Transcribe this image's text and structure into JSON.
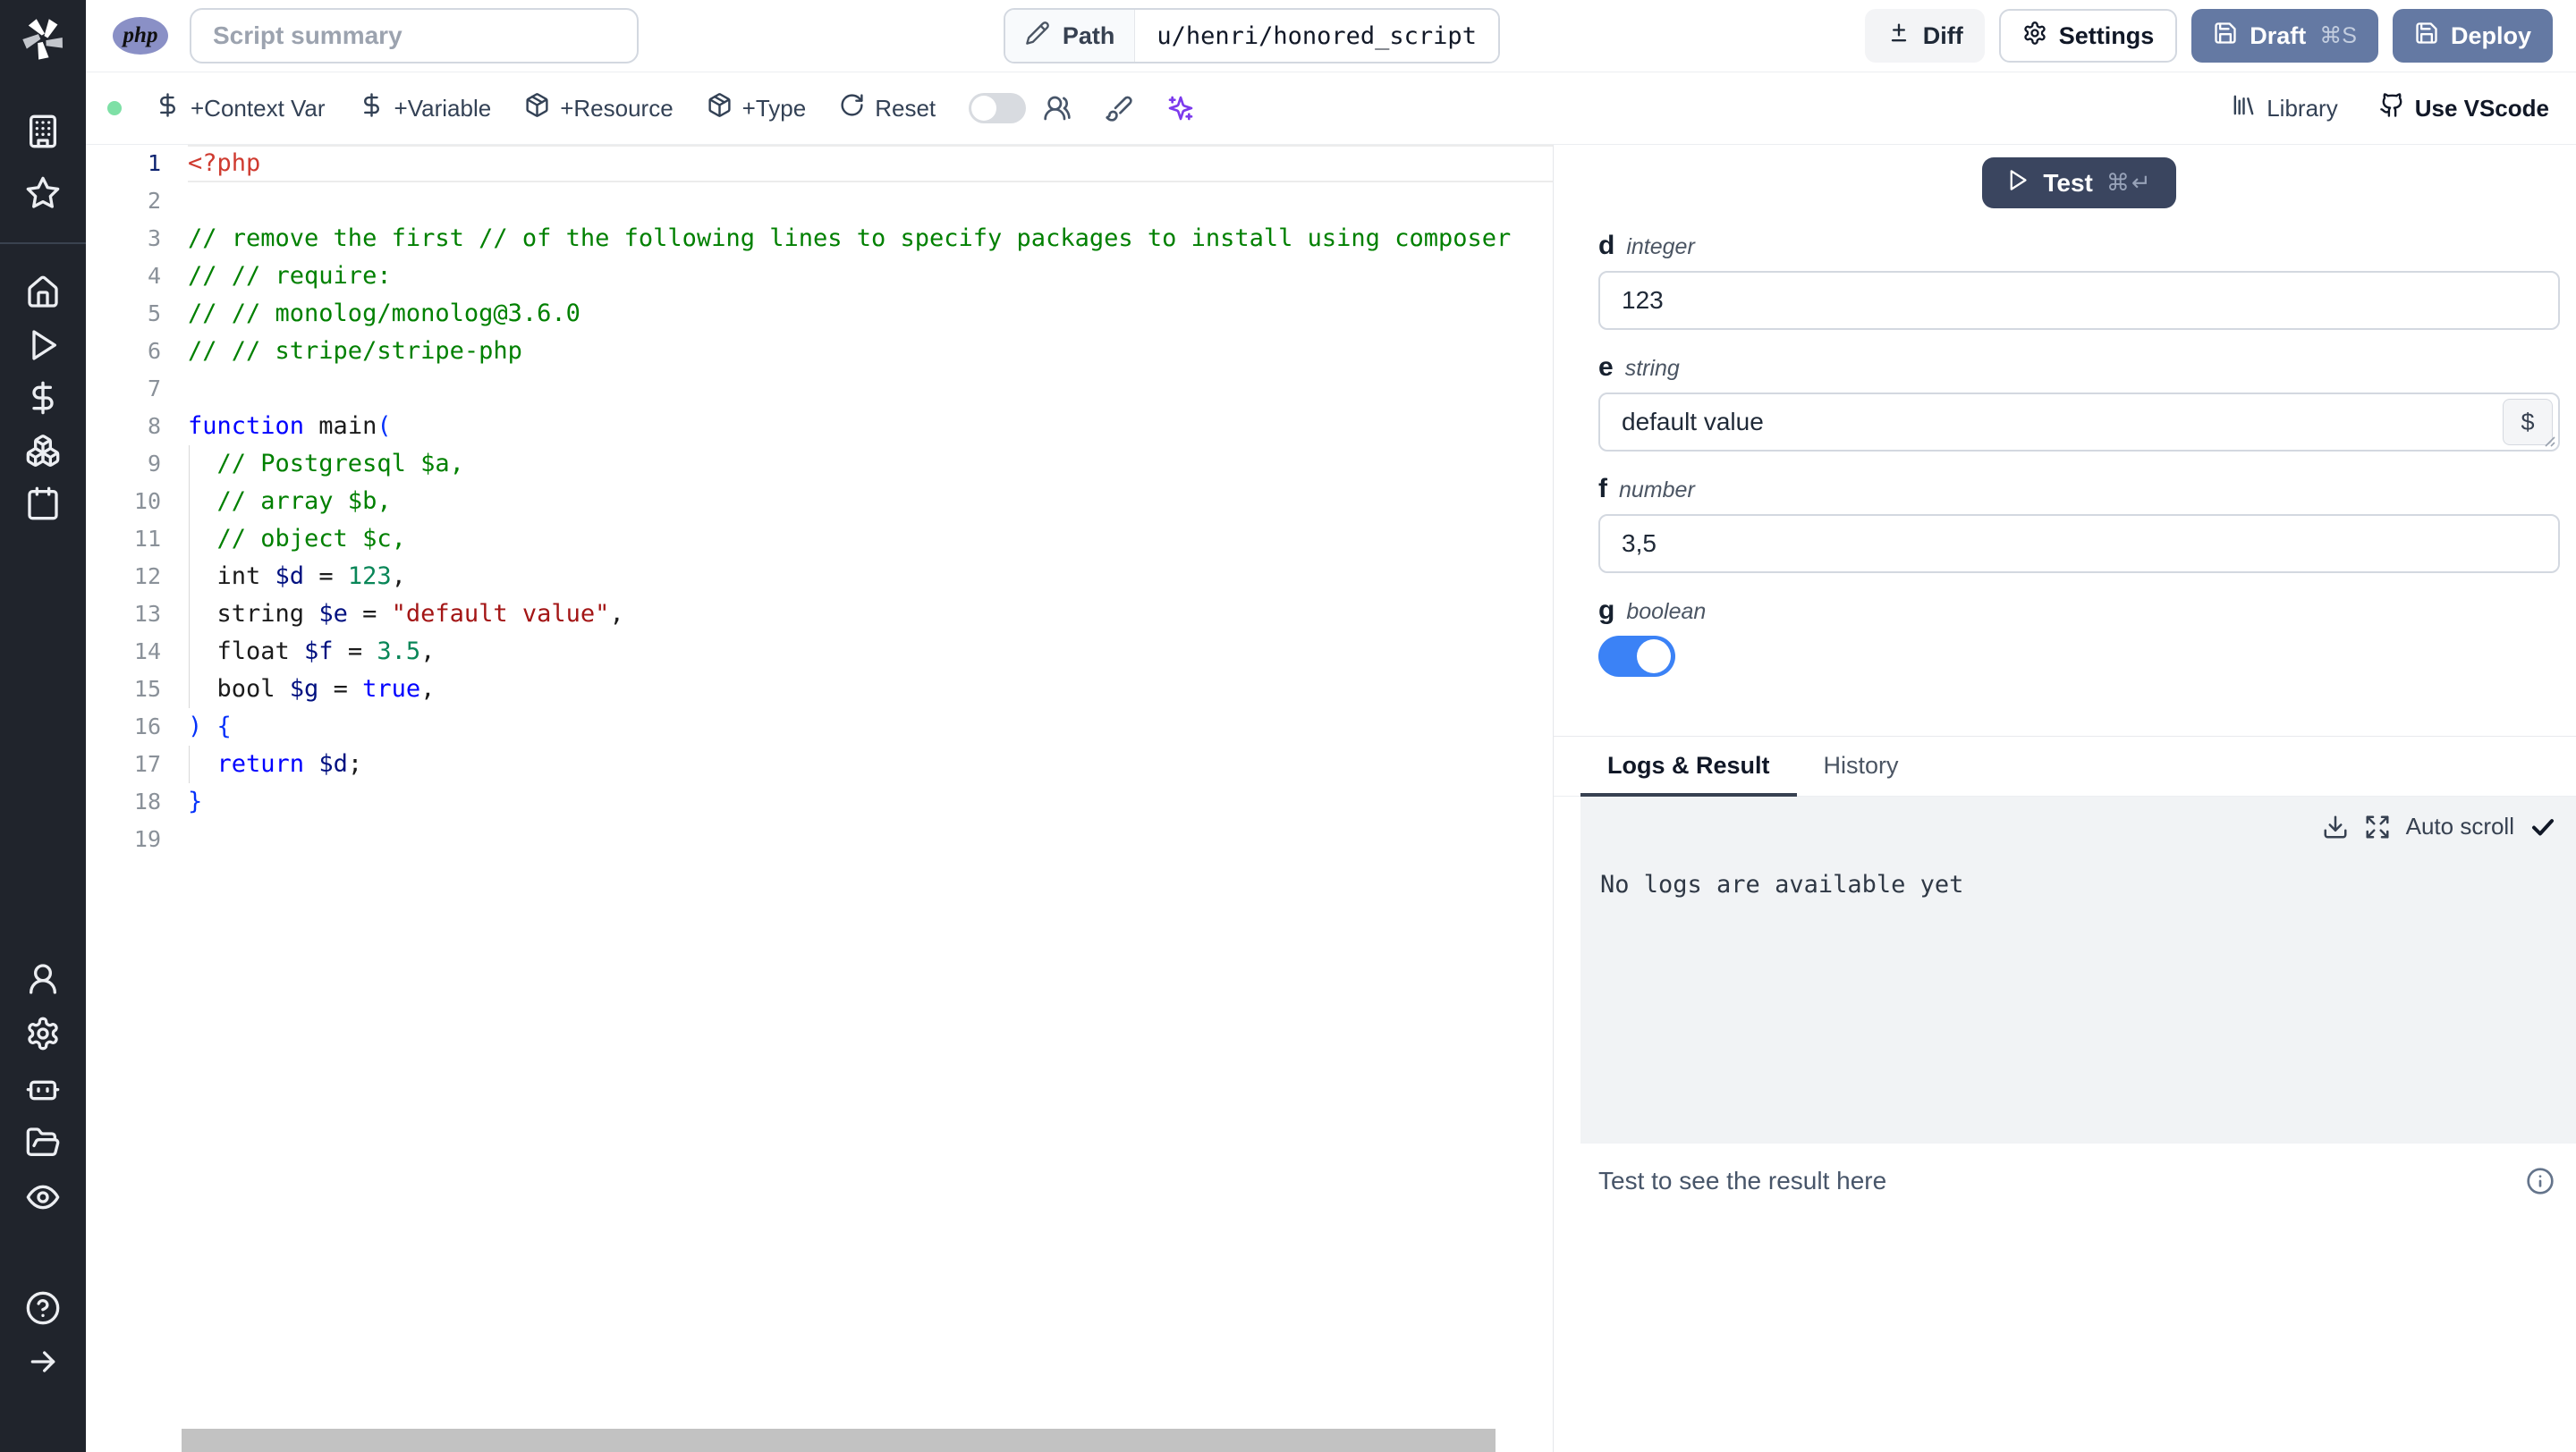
{
  "app": {
    "name": "Windmill script editor"
  },
  "colors": {
    "sidebar_bg": "#20242c",
    "slate_button": "#6479a3",
    "test_button": "#3a455f",
    "toggle_on": "#3b82f6",
    "php_badge": "#8a90c6",
    "status_dot": "#7ee0a6",
    "logs_bg": "#f1f3f5",
    "ai_accent": "#7c3aed",
    "code_meta": "#cf3b30",
    "code_comment": "#008000",
    "code_keyword": "#0000ff",
    "code_variable": "#001080",
    "code_number": "#098658",
    "code_string": "#a31515",
    "code_bracket": "#0431fa"
  },
  "header": {
    "language_badge": "php",
    "summary_placeholder": "Script summary",
    "path_label": "Path",
    "path_value": "u/henri/honored_script",
    "diff_label": "Diff",
    "settings_label": "Settings",
    "draft_label": "Draft",
    "draft_shortcut": "⌘S",
    "deploy_label": "Deploy"
  },
  "sidebar": {
    "top_icons": [
      "building",
      "star"
    ],
    "mid_icons": [
      "home",
      "play",
      "dollar",
      "boxes",
      "calendar"
    ],
    "lower_icons": [
      "user",
      "settings",
      "bot",
      "folder-open",
      "eye"
    ],
    "footer_icons": [
      "help-circle",
      "arrow-right"
    ]
  },
  "toolbar": {
    "items": [
      {
        "icon": "dollar",
        "label": "+Context Var"
      },
      {
        "icon": "dollar",
        "label": "+Variable"
      },
      {
        "icon": "package",
        "label": "+Resource"
      },
      {
        "icon": "package",
        "label": "+Type"
      },
      {
        "icon": "refresh",
        "label": "Reset"
      }
    ],
    "multiplayer_toggle_on": false,
    "icon_buttons": [
      "users",
      "brush",
      "sparkles"
    ],
    "library_label": "Library",
    "vscode_label": "Use VScode"
  },
  "editor": {
    "active_line": 1,
    "lines": [
      {
        "n": 1,
        "tokens": [
          {
            "t": "<?php",
            "c": "meta"
          }
        ]
      },
      {
        "n": 2,
        "tokens": []
      },
      {
        "n": 3,
        "tokens": [
          {
            "t": "// remove the first // of the following lines to specify packages to install using composer",
            "c": "comment"
          }
        ]
      },
      {
        "n": 4,
        "tokens": [
          {
            "t": "// // require:",
            "c": "comment"
          }
        ]
      },
      {
        "n": 5,
        "tokens": [
          {
            "t": "// // monolog/monolog@3.6.0",
            "c": "comment"
          }
        ]
      },
      {
        "n": 6,
        "tokens": [
          {
            "t": "// // stripe/stripe-php",
            "c": "comment"
          }
        ]
      },
      {
        "n": 7,
        "tokens": []
      },
      {
        "n": 8,
        "tokens": [
          {
            "t": "function",
            "c": "kw"
          },
          {
            "t": " main",
            "c": "plain"
          },
          {
            "t": "(",
            "c": "bracket"
          }
        ]
      },
      {
        "n": 9,
        "guide": true,
        "tokens": [
          {
            "t": "  // Postgresql $a,",
            "c": "comment"
          }
        ]
      },
      {
        "n": 10,
        "guide": true,
        "tokens": [
          {
            "t": "  // array $b,",
            "c": "comment"
          }
        ]
      },
      {
        "n": 11,
        "guide": true,
        "tokens": [
          {
            "t": "  // object $c,",
            "c": "comment"
          }
        ]
      },
      {
        "n": 12,
        "guide": true,
        "tokens": [
          {
            "t": "  int ",
            "c": "plain"
          },
          {
            "t": "$d",
            "c": "var"
          },
          {
            "t": " = ",
            "c": "plain"
          },
          {
            "t": "123",
            "c": "num"
          },
          {
            "t": ",",
            "c": "plain"
          }
        ]
      },
      {
        "n": 13,
        "guide": true,
        "tokens": [
          {
            "t": "  string ",
            "c": "plain"
          },
          {
            "t": "$e",
            "c": "var"
          },
          {
            "t": " = ",
            "c": "plain"
          },
          {
            "t": "\"default value\"",
            "c": "str"
          },
          {
            "t": ",",
            "c": "plain"
          }
        ]
      },
      {
        "n": 14,
        "guide": true,
        "tokens": [
          {
            "t": "  float ",
            "c": "plain"
          },
          {
            "t": "$f",
            "c": "var"
          },
          {
            "t": " = ",
            "c": "plain"
          },
          {
            "t": "3.5",
            "c": "num"
          },
          {
            "t": ",",
            "c": "plain"
          }
        ]
      },
      {
        "n": 15,
        "guide": true,
        "tokens": [
          {
            "t": "  bool ",
            "c": "plain"
          },
          {
            "t": "$g",
            "c": "var"
          },
          {
            "t": " = ",
            "c": "plain"
          },
          {
            "t": "true",
            "c": "kw"
          },
          {
            "t": ",",
            "c": "plain"
          }
        ]
      },
      {
        "n": 16,
        "tokens": [
          {
            "t": ") {",
            "c": "bracket"
          }
        ]
      },
      {
        "n": 17,
        "guide": true,
        "tokens": [
          {
            "t": "  ",
            "c": "plain"
          },
          {
            "t": "return",
            "c": "kw"
          },
          {
            "t": " ",
            "c": "plain"
          },
          {
            "t": "$d",
            "c": "var"
          },
          {
            "t": ";",
            "c": "plain"
          }
        ]
      },
      {
        "n": 18,
        "tokens": [
          {
            "t": "}",
            "c": "bracket"
          }
        ]
      },
      {
        "n": 19,
        "tokens": []
      }
    ]
  },
  "run_panel": {
    "test_label": "Test",
    "test_shortcut": "⌘↵",
    "fields": [
      {
        "name": "d",
        "type": "integer",
        "value": "123",
        "control": "input"
      },
      {
        "name": "e",
        "type": "string",
        "value": "default value",
        "control": "textarea",
        "button": "$"
      },
      {
        "name": "f",
        "type": "number",
        "value": "3,5",
        "control": "input"
      },
      {
        "name": "g",
        "type": "boolean",
        "value": true,
        "control": "toggle"
      }
    ],
    "tabs": [
      {
        "label": "Logs & Result",
        "active": true
      },
      {
        "label": "History",
        "active": false
      }
    ],
    "autoscroll_label": "Auto scroll",
    "logs_empty": "No logs are available yet",
    "result_placeholder": "Test to see the result here"
  }
}
